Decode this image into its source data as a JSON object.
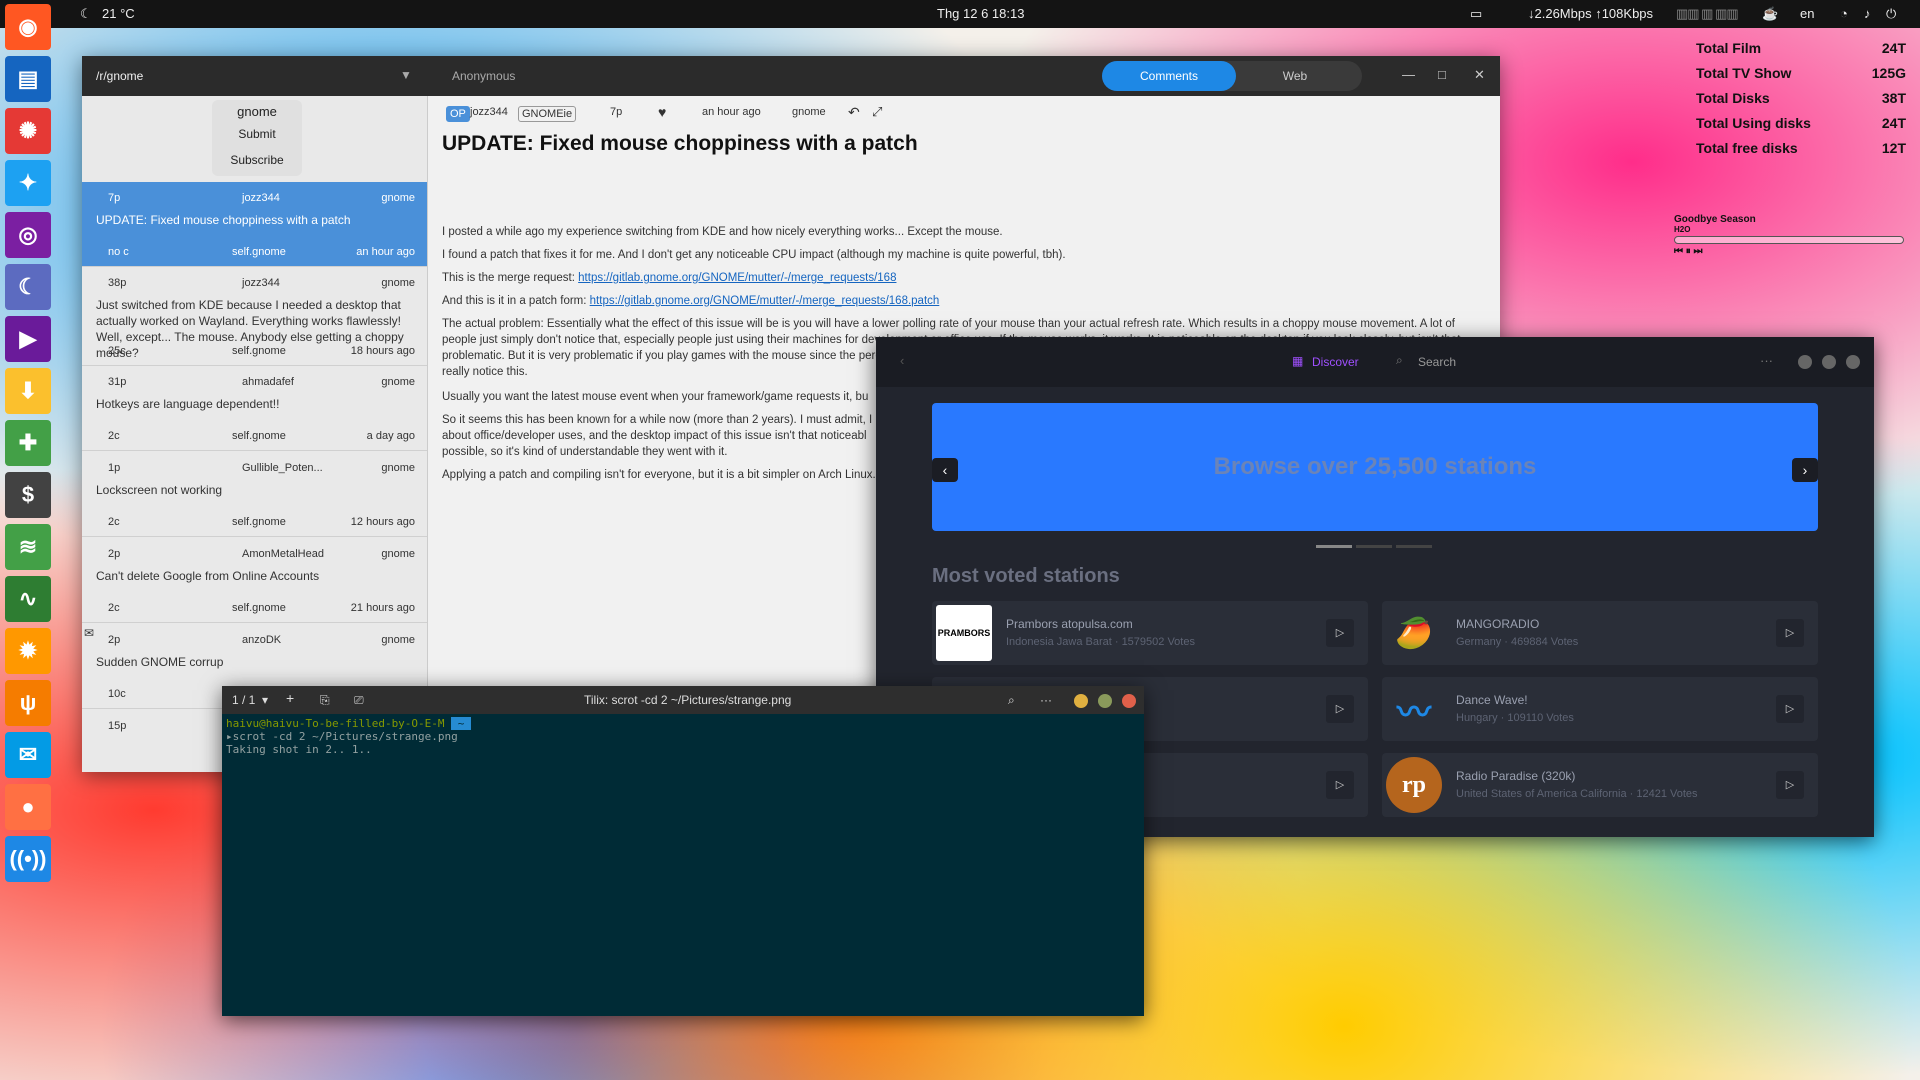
{
  "topbar": {
    "weather": "21 °C",
    "datetime": "Thg 12 6  18:13",
    "net": "↓2.26Mbps ↑108Kbps",
    "lang": "en"
  },
  "conky": [
    {
      "label": "Total Film",
      "value": "24T"
    },
    {
      "label": "Total TV Show",
      "value": "125G"
    },
    {
      "label": "Total Disks",
      "value": "38T"
    },
    {
      "label": "Total Using disks",
      "value": "24T"
    },
    {
      "label": "Total free disks",
      "value": "12T"
    }
  ],
  "music": {
    "title": "Goodbye Season",
    "artist": "H2O"
  },
  "reddit": {
    "subreddit": "/r/gnome",
    "user": "Anonymous",
    "tabs": [
      "Comments",
      "Web"
    ],
    "menu": {
      "title": "gnome",
      "submit": "Submit",
      "subscribe": "Subscribe"
    },
    "posts": [
      {
        "points": "7p",
        "author": "jozz344",
        "sub": "gnome",
        "title": "UPDATE: Fixed mouse choppiness with a patch",
        "comments": "no c",
        "domain": "self.gnome",
        "time": "an hour ago"
      },
      {
        "points": "38p",
        "author": "jozz344",
        "sub": "gnome",
        "title": "Just switched from KDE because I needed a desktop that actually worked on Wayland. Everything works flawlessly! Well, except... The mouse. Anybody else getting a choppy mouse?",
        "comments": "25c",
        "domain": "self.gnome",
        "time": "18 hours ago"
      },
      {
        "points": "31p",
        "author": "ahmadafef",
        "sub": "gnome",
        "title": "Hotkeys are language dependent!!",
        "comments": "2c",
        "domain": "self.gnome",
        "time": "a day ago"
      },
      {
        "points": "1p",
        "author": "Gullible_Poten...",
        "sub": "gnome",
        "title": "Lockscreen not working",
        "comments": "2c",
        "domain": "self.gnome",
        "time": "12 hours ago"
      },
      {
        "points": "2p",
        "author": "AmonMetalHead",
        "sub": "gnome",
        "title": "Can't delete Google from Online Accounts",
        "comments": "2c",
        "domain": "self.gnome",
        "time": "21 hours ago"
      },
      {
        "points": "2p",
        "author": "anzoDK",
        "sub": "gnome",
        "title": "Sudden GNOME corrup",
        "comments": "10c",
        "domain": "",
        "time": ""
      },
      {
        "points": "15p",
        "author": "",
        "sub": "",
        "title": "",
        "comments": "",
        "domain": "",
        "time": ""
      }
    ],
    "article": {
      "op": "OP",
      "author": "jozz344",
      "flair": "GNOMEie",
      "points": "7p",
      "time": "an hour ago",
      "sub": "gnome",
      "title": "UPDATE: Fixed mouse choppiness with a patch",
      "p1": "I posted a while ago my experience switching from KDE and how nicely everything works... Except the mouse.",
      "p2": "I found a patch that fixes it for me. And I don't get any noticeable CPU impact (although my machine is quite powerful, tbh).",
      "p3": "This is the merge request: ",
      "link1": "https://gitlab.gnome.org/GNOME/mutter/-/merge_requests/168",
      "p4": "And this is it in a patch form: ",
      "link2": "https://gitlab.gnome.org/GNOME/mutter/-/merge_requests/168.patch",
      "p5": "The actual problem: Essentially what the effect of this issue will be is you will have a lower polling rate of your mouse than your actual refresh rate. Which results in a choppy mouse movement. A lot of people just simply don't notice that, especially people just using their machines for development or office use. If the mouse works, it works. It is noticeable on the desktop if you look closely, but isn't that problematic. But it is very problematic if you play games with the mouse since the perceived mouse accuracy is much lower. People with low powered machines playing games at 30fps or less also might not really notice this.",
      "p6": "Usually you want the latest mouse event when your framework/game requests it, bu",
      "p7": "So it seems this has been known for a while now (more than 2 years). I must admit, I",
      "p7b": "about office/developer uses, and the desktop impact of this issue isn't that noticeabl",
      "p7c": "possible, so it's kind of understandable they went with it.",
      "p8": "Applying a patch and compiling isn't for everyone, but it is a bit simpler on Arch Linux. I"
    }
  },
  "radio": {
    "discover": "Discover",
    "search": "Search",
    "banner": "Browse over 25,500 stations",
    "most_voted": "Most voted stations",
    "stations": [
      {
        "name": "Prambors atopulsa.com",
        "sub": "Indonesia Jawa Barat · 1579502 Votes",
        "logo": "PRAMBORS"
      },
      {
        "name": "MANGORADIO",
        "sub": "Germany · 469884 Votes",
        "logo": "🥭"
      },
      {
        "name": "",
        "sub": "",
        "logo": ""
      },
      {
        "name": "Dance Wave!",
        "sub": "Hungary · 109110 Votes",
        "logo": "〰"
      },
      {
        "name": "",
        "sub": "",
        "logo": ""
      },
      {
        "name": "Radio Paradise (320k)",
        "sub": "United States of America California · 12421 Votes",
        "logo": "rp"
      }
    ]
  },
  "terminal": {
    "tab": "1 / 1",
    "title": "Tilix: scrot -cd 2 ~/Pictures/strange.png",
    "prompt": "haivu@haivu-To-be-filled-by-O-E-M",
    "cmd": "scrot -cd 2 ~/Pictures/strange.png",
    "out": "Taking shot in 2.. 1.."
  },
  "colors": {
    "accent": "#1e88e5",
    "terminal_bg": "#002b36",
    "radio_bg": "#22252e"
  }
}
